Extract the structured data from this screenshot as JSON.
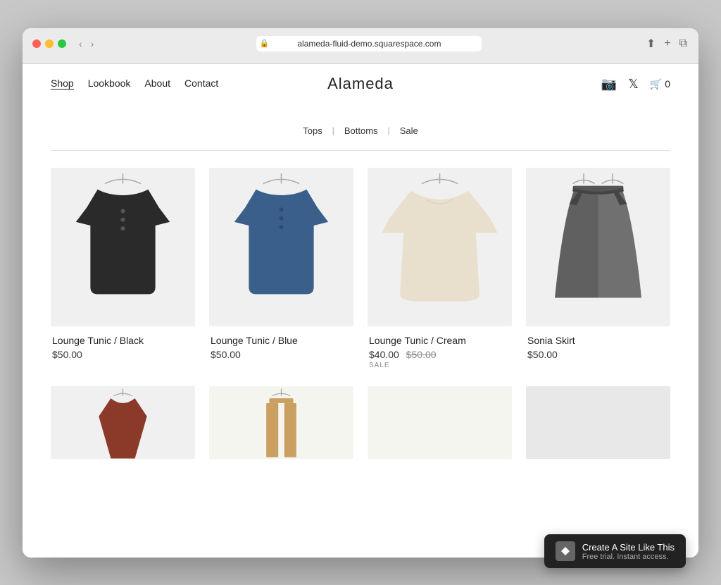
{
  "browser": {
    "url": "alameda-fluid-demo.squarespace.com",
    "back_label": "‹",
    "forward_label": "›",
    "reload_label": "↻"
  },
  "nav": {
    "links": [
      {
        "label": "Shop",
        "active": true
      },
      {
        "label": "Lookbook",
        "active": false
      },
      {
        "label": "About",
        "active": false
      },
      {
        "label": "Contact",
        "active": false
      }
    ],
    "site_title": "Alameda",
    "cart_label": "0"
  },
  "categories": [
    {
      "label": "Tops"
    },
    {
      "label": "Bottoms"
    },
    {
      "label": "Sale"
    }
  ],
  "products": [
    {
      "name": "Lounge Tunic / Black",
      "price": "$50.00",
      "sale_price": null,
      "original_price": null,
      "on_sale": false,
      "color": "#2a2a2a",
      "style": "tunic"
    },
    {
      "name": "Lounge Tunic / Blue",
      "price": "$50.00",
      "sale_price": null,
      "original_price": null,
      "on_sale": false,
      "color": "#3a5f8a",
      "style": "tunic"
    },
    {
      "name": "Lounge Tunic / Cream",
      "price": "$40.00",
      "sale_price": "$40.00",
      "original_price": "$50.00",
      "on_sale": true,
      "color": "#e8e0cc",
      "style": "tunic-wide"
    },
    {
      "name": "Sonia Skirt",
      "price": "$50.00",
      "sale_price": null,
      "original_price": null,
      "on_sale": false,
      "color": "#606060",
      "style": "skirt"
    }
  ],
  "bottom_products": [
    {
      "color": "#8b3a2a",
      "style": "vest"
    },
    {
      "color": "#c9a060",
      "style": "pants"
    },
    {
      "color": "#d0c8b8",
      "style": "skirt2"
    }
  ],
  "squarespace_banner": {
    "main": "Create A Site Like This",
    "sub": "Free trial. Instant access."
  }
}
